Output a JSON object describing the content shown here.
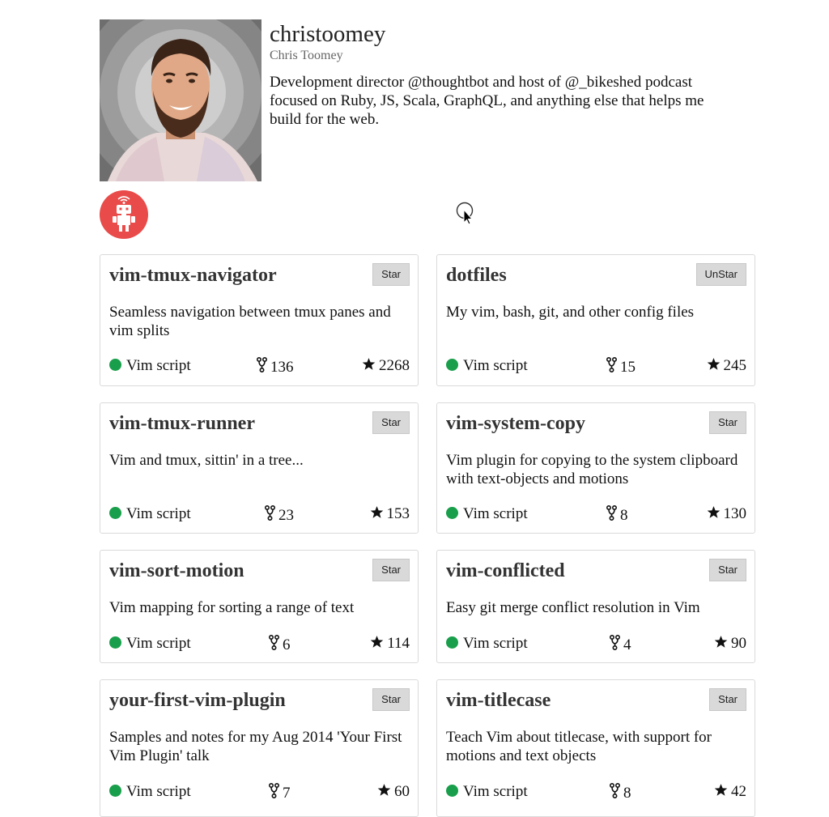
{
  "profile": {
    "username": "christoomey",
    "fullname": "Chris Toomey",
    "bio": "Development director @thoughtbot and host of @_bikeshed podcast focused on Ruby, JS, Scala, GraphQL, and anything else that helps me build for the web."
  },
  "colors": {
    "language_dot": "#199f4b",
    "badge": "#e84b49",
    "button_bg": "#d9d9d9"
  },
  "repos": [
    {
      "name": "vim-tmux-navigator",
      "button": "Star",
      "description": "Seamless navigation between tmux panes and vim splits",
      "language": "Vim script",
      "forks": "136",
      "stars": "2268"
    },
    {
      "name": "dotfiles",
      "button": "UnStar",
      "description": "My vim, bash, git, and other config files",
      "language": "Vim script",
      "forks": "15",
      "stars": "245"
    },
    {
      "name": "vim-tmux-runner",
      "button": "Star",
      "description": "Vim and tmux, sittin' in a tree...",
      "language": "Vim script",
      "forks": "23",
      "stars": "153"
    },
    {
      "name": "vim-system-copy",
      "button": "Star",
      "description": "Vim plugin for copying to the system clipboard with text-objects and motions",
      "language": "Vim script",
      "forks": "8",
      "stars": "130"
    },
    {
      "name": "vim-sort-motion",
      "button": "Star",
      "description": "Vim mapping for sorting a range of text",
      "language": "Vim script",
      "forks": "6",
      "stars": "114"
    },
    {
      "name": "vim-conflicted",
      "button": "Star",
      "description": "Easy git merge conflict resolution in Vim",
      "language": "Vim script",
      "forks": "4",
      "stars": "90"
    },
    {
      "name": "your-first-vim-plugin",
      "button": "Star",
      "description": "Samples and notes for my Aug 2014 'Your First Vim Plugin' talk",
      "language": "Vim script",
      "forks": "7",
      "stars": "60"
    },
    {
      "name": "vim-titlecase",
      "button": "Star",
      "description": "Teach Vim about titlecase, with support for motions and text objects",
      "language": "Vim script",
      "forks": "8",
      "stars": "42"
    }
  ]
}
